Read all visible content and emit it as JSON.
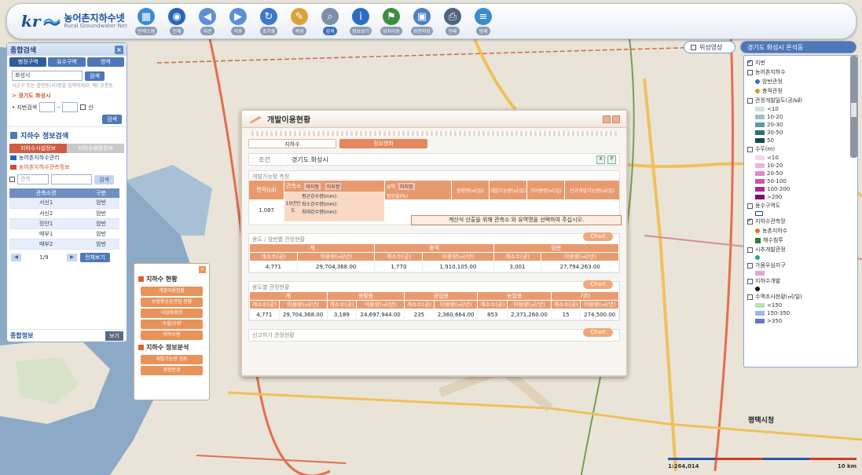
{
  "app": {
    "logo_mark": "kr",
    "logo_title": "농어촌지하수넷",
    "logo_subtitle": "Rural Groundwater Net"
  },
  "toolbar": {
    "buttons": [
      {
        "label": "인덱스맵",
        "icon": "index-map-icon",
        "color": "#3b8bd4"
      },
      {
        "label": "전체",
        "icon": "globe-icon",
        "color": "#2767b6"
      },
      {
        "label": "이전",
        "icon": "back-icon",
        "color": "#5d8fd5"
      },
      {
        "label": "이후",
        "icon": "forward-icon",
        "color": "#5d8fd5"
      },
      {
        "label": "초기화",
        "icon": "refresh-icon",
        "color": "#3e79c7"
      },
      {
        "label": "측정",
        "icon": "measure-icon",
        "color": "#d9a23a"
      },
      {
        "label": "검색",
        "icon": "search-icon",
        "color": "#7c8fa9"
      },
      {
        "label": "정보보기",
        "icon": "info-icon",
        "color": "#2f6dc4"
      },
      {
        "label": "위치이동",
        "icon": "location-icon",
        "color": "#3f8c45"
      },
      {
        "label": "화면저장",
        "icon": "save-screen-icon",
        "color": "#4e7fbf"
      },
      {
        "label": "인쇄",
        "icon": "print-icon",
        "color": "#50647f"
      },
      {
        "label": "범례",
        "icon": "legend-icon",
        "color": "#3b8bd4"
      }
    ]
  },
  "map_tabs": {
    "aerial": "위성영상",
    "region": "경기도 화성시 온석동"
  },
  "left_panel": {
    "title": "종합검색",
    "tabs": [
      "행정구역",
      "유수구역",
      "영역"
    ],
    "search_value": "화성시",
    "search_button": "검색",
    "hint": "시군구 또는 읍면동(리)명을 입력하세요. 예) 공릉동",
    "current_area": "> 경기도 화성시",
    "parcel_label": "• 지번검색",
    "parcel_check": "산",
    "parcel_button": "검색",
    "gw_title": "지하수 정보검색",
    "gw_tabs": [
      "지하수시설정보",
      "지하수용량정보"
    ],
    "mgmt_item": "농어촌지하수관리",
    "obs_item": "농어촌지하수관측정보",
    "filter_placeholder": "관측",
    "filter_button": "검색",
    "table_headers": [
      "관측소명",
      "구분"
    ],
    "table_rows": [
      [
        "서신1",
        "암반"
      ],
      [
        "서신2",
        "암반"
      ],
      [
        "장안1",
        "암반"
      ],
      [
        "매부1",
        "암반"
      ],
      [
        "매부2",
        "암반"
      ]
    ],
    "page_info": "1/9",
    "view_all": "전체보기",
    "info_label": "종합정보",
    "info_button": "보기"
  },
  "popup_menu": {
    "section1": "지하수 현황",
    "buttons1": [
      "개발이용현황",
      "농업용공공관정 현황",
      "이상용확정",
      "수질/수량",
      "지하수원"
    ],
    "section2": "지하수 정보분석",
    "buttons2": [
      "개발가능량 검토",
      "영향반경"
    ]
  },
  "dialog": {
    "title": "개발이용현황",
    "tabs": [
      "지하수",
      "정요영화"
    ],
    "cond_key": "조건",
    "cond_value": "경기도 화성시",
    "box1_title": "개발가능량 측정",
    "box1": {
      "area_label": "면적(㎢)",
      "area_value": "1,087",
      "obs_label": "관측소",
      "obs_sel1": "미지정",
      "obs_sel2": "미지정",
      "year_label": "10년빈도",
      "rain1": "평균강수량(mm):",
      "rain2": "최소강수량(mm):",
      "rain3": "최대강수량(mm):",
      "basin_label": "유역",
      "basin_sel": "미지정",
      "infil": "함양율(%)",
      "col_a": "함양량(㎥/일)",
      "col_b": "개발가능량(㎥/일)",
      "col_c": "기이용량(㎥/일)",
      "col_d": "신규개발가능량(㎥/일)",
      "message": "계산식 산출을 위해 관측소 와 유역명을 선택하여 주십시오."
    },
    "box2_title": "용도 / 암반별 관정현황",
    "box2_chart": "Chart",
    "box2_groups": [
      "계",
      "충적",
      "암반"
    ],
    "box2_subheads": [
      "개소수(공)",
      "이용량(㎥/년)"
    ],
    "box2_values": [
      "4,771",
      "29,704,368.00",
      "1,770",
      "1,910,105.00",
      "3,001",
      "27,794,263.00"
    ],
    "box3_title": "용도별 관정현황",
    "box3_chart": "Chart",
    "box3_groups": [
      "계",
      "생활용",
      "공업용",
      "농업용",
      "기타"
    ],
    "box3_values": [
      "4,771",
      "29,704,368.00",
      "3,189",
      "24,697,944.00",
      "235",
      "2,360,664.00",
      "853",
      "2,371,260.00",
      "15",
      "274,500.00"
    ],
    "box4_title": "신고허가 관정현황",
    "box4_chart": "Chart"
  },
  "legend": {
    "items": [
      {
        "type": "check",
        "label": "지번",
        "on": true
      },
      {
        "type": "check",
        "label": "농어촌지하수",
        "on": false
      },
      {
        "type": "sub",
        "label": "암반관정",
        "color": "#3b6fc2",
        "shape": "dot"
      },
      {
        "type": "sub",
        "label": "충적관정",
        "color": "#d99a28",
        "shape": "dot"
      },
      {
        "type": "check",
        "label": "관정개발밀도(공/㎢)",
        "on": false
      },
      {
        "type": "sub",
        "label": "<10",
        "color": "#cfe2dc"
      },
      {
        "type": "sub",
        "label": "10-20",
        "color": "#99c4bd"
      },
      {
        "type": "sub",
        "label": "20-30",
        "color": "#5d9c9a"
      },
      {
        "type": "sub",
        "label": "30-50",
        "color": "#2f7071"
      },
      {
        "type": "sub",
        "label": "50",
        "color": "#164a4b"
      },
      {
        "type": "check",
        "label": "수두(m)",
        "on": false
      },
      {
        "type": "sub",
        "label": "<10",
        "color": "#f4d6ec"
      },
      {
        "type": "sub",
        "label": "10-20",
        "color": "#eab5dc"
      },
      {
        "type": "sub",
        "label": "20-50",
        "color": "#de8acb"
      },
      {
        "type": "sub",
        "label": "50-100",
        "color": "#cc56b3"
      },
      {
        "type": "sub",
        "label": "100-200",
        "color": "#a92a8f"
      },
      {
        "type": "sub",
        "label": ">200",
        "color": "#7c0b6a"
      },
      {
        "type": "check",
        "label": "용수구역도",
        "on": false
      },
      {
        "type": "sub",
        "label": "",
        "color": "#ffffff",
        "shape": "outline"
      },
      {
        "type": "check",
        "label": "지하수관측망",
        "on": true
      },
      {
        "type": "sub",
        "label": "농촌지하수",
        "color": "#d9751f",
        "shape": "dot"
      },
      {
        "type": "sub",
        "label": "해수침투",
        "color": "#2f7a3a",
        "shape": "sq"
      },
      {
        "type": "check",
        "label": "시추개발관정",
        "on": false
      },
      {
        "type": "sub",
        "label": "",
        "color": "#2aa090",
        "shape": "dot"
      },
      {
        "type": "check",
        "label": "가뭄우심지구",
        "on": false
      },
      {
        "type": "sub",
        "label": "",
        "color": "#e4a3d6"
      },
      {
        "type": "check",
        "label": "지하수개발",
        "on": false
      },
      {
        "type": "sub",
        "label": "",
        "color": "#111111",
        "shape": "dot"
      },
      {
        "type": "check",
        "label": "수맥조사현황(㎥/일)",
        "on": false
      },
      {
        "type": "sub",
        "label": "<150",
        "color": "#b9e3b2"
      },
      {
        "type": "sub",
        "label": "150-350",
        "color": "#9db7e8"
      },
      {
        "type": "sub",
        "label": ">350",
        "color": "#6b74c8"
      }
    ]
  },
  "map": {
    "city_label": "평택시청",
    "scale_text": "1:264,014",
    "scale_unit": "10 km"
  },
  "colors": {
    "accent": "#4d78b9",
    "orange": "#e89a6f",
    "sea": "#7aa0c0",
    "land": "#e7e2d4"
  }
}
